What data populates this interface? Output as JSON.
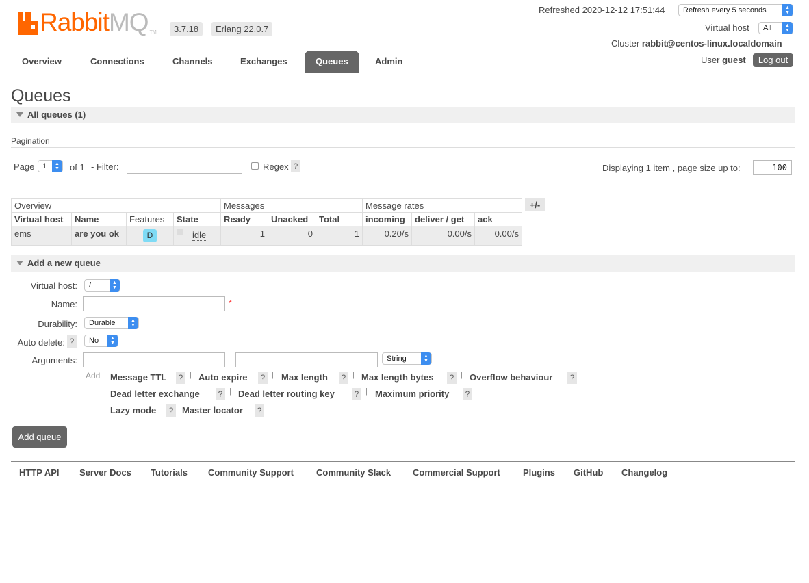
{
  "brand": {
    "rabbit": "Rabbit",
    "mq": "MQ",
    "tm": "TM",
    "color": "#ff6600"
  },
  "header": {
    "version": "3.7.18",
    "erlang": "Erlang 22.0.7",
    "refreshed_label": "Refreshed 2020-12-12 17:51:44",
    "refresh_select": "Refresh every 5 seconds",
    "vhost_label": "Virtual host",
    "vhost_select": "All",
    "cluster_label": "Cluster",
    "cluster_name": "rabbit@centos-linux.localdomain",
    "user_label": "User",
    "user_name": "guest",
    "logout": "Log out"
  },
  "tabs": [
    {
      "label": "Overview"
    },
    {
      "label": "Connections"
    },
    {
      "label": "Channels"
    },
    {
      "label": "Exchanges"
    },
    {
      "label": "Queues",
      "active": true
    },
    {
      "label": "Admin"
    }
  ],
  "page_title": "Queues",
  "all_queues": {
    "title": "All queues (1)"
  },
  "pagination": {
    "label": "Pagination",
    "page_label": "Page",
    "page_value": "1",
    "of_label": "of 1",
    "filter_label": "- Filter:",
    "filter_value": "",
    "regex_label": "Regex",
    "help": "?",
    "displaying": "Displaying 1 item , page size up to:",
    "page_size": "100"
  },
  "table": {
    "groups": [
      "Overview",
      "Messages",
      "Message rates"
    ],
    "columns": [
      "Virtual host",
      "Name",
      "Features",
      "State",
      "Ready",
      "Unacked",
      "Total",
      "incoming",
      "deliver / get",
      "ack"
    ],
    "rows": [
      {
        "vhost": "ems",
        "name": "are you ok",
        "feature": "D",
        "state": "idle",
        "ready": "1",
        "unacked": "0",
        "total": "1",
        "incoming": "0.20/s",
        "deliver_get": "0.00/s",
        "ack": "0.00/s"
      }
    ],
    "toggle_columns": "+/-"
  },
  "add_queue": {
    "title": "Add a new queue",
    "vhost_label": "Virtual host:",
    "vhost_value": "/",
    "name_label": "Name:",
    "name_value": "",
    "required_mark": "*",
    "durability_label": "Durability:",
    "durability_value": "Durable",
    "auto_delete_label": "Auto delete:",
    "auto_delete_value": "No",
    "arguments_label": "Arguments:",
    "arg_key": "",
    "equals": "=",
    "arg_value": "",
    "arg_type": "String",
    "add_label": "Add",
    "arg_links": [
      "Message TTL",
      "Auto expire",
      "Max length",
      "Max length bytes",
      "Overflow behaviour",
      "Dead letter exchange",
      "Dead letter routing key",
      "Maximum priority",
      "Lazy mode",
      "Master locator"
    ],
    "separator": "|",
    "submit": "Add queue"
  },
  "footer": {
    "links": [
      "HTTP API",
      "Server Docs",
      "Tutorials",
      "Community Support",
      "Community Slack",
      "Commercial Support",
      "Plugins",
      "GitHub",
      "Changelog"
    ]
  }
}
